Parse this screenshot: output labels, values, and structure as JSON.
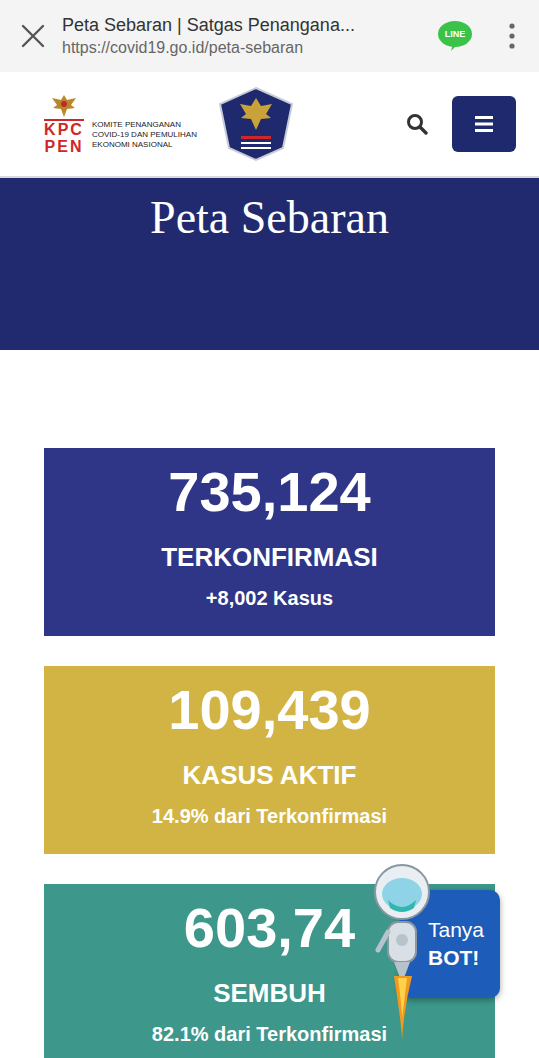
{
  "browser": {
    "title": "Peta Sebaran | Satgas Penangana...",
    "url": "https://covid19.go.id/peta-sebaran",
    "line_label": "LINE"
  },
  "header": {
    "logo_letters": [
      "KPC",
      "PEN"
    ],
    "logo_lines": [
      "KOMITE PENANGANAN",
      "COVID-19 DAN PEMULIHAN",
      "EKONOMI NASIONAL"
    ]
  },
  "banner": {
    "title": "Peta Sebaran"
  },
  "stats": [
    {
      "value": "735,124",
      "label": "TERKONFIRMASI",
      "note": "+8,002 Kasus",
      "color": "#2f3687"
    },
    {
      "value": "109,439",
      "label": "KASUS AKTIF",
      "note": "14.9% dari Terkonfirmasi",
      "color": "#d2b444"
    },
    {
      "value": "603,74",
      "label": "SEMBUH",
      "note": "82.1% dari Terkonfirmasi",
      "color": "#3d978a"
    }
  ],
  "bot": {
    "lines": [
      "Tanya",
      "BOT!"
    ]
  }
}
